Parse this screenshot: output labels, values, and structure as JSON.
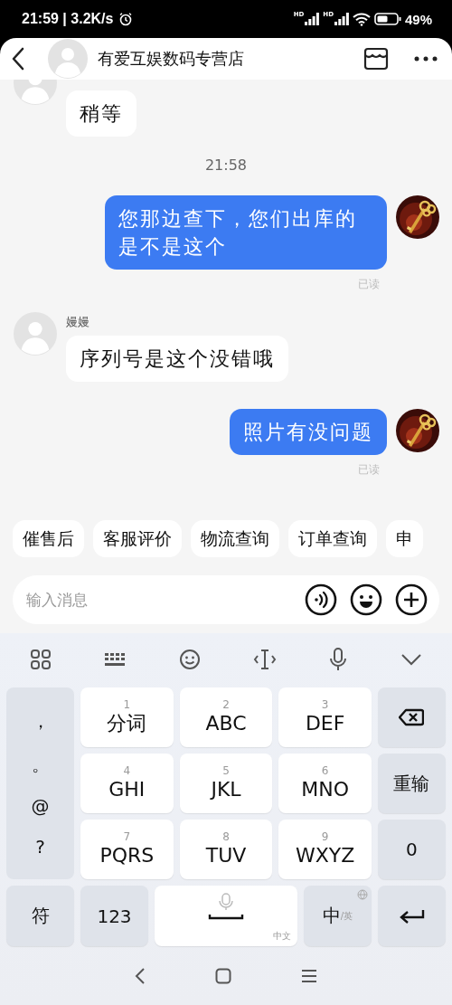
{
  "status_bar": {
    "clock": "21:59 | 3.2K/s",
    "signals": [
      "HD",
      "HD"
    ],
    "battery": "49%"
  },
  "header": {
    "title": "有爱互娱数码专营店"
  },
  "messages": [
    {
      "kind": "incoming",
      "text": "稍等"
    },
    {
      "kind": "time",
      "text": "21:58"
    },
    {
      "kind": "outgoing",
      "text": "您那边查下，您们出库的是不是这个",
      "status": "已读"
    },
    {
      "kind": "incoming",
      "name": "嫚嫚",
      "text": "序列号是这个没错哦"
    },
    {
      "kind": "outgoing",
      "text": "照片有没问题",
      "status": "已读"
    }
  ],
  "quick_replies": [
    "催售后",
    "客服评价",
    "物流查询",
    "订单查询",
    "申"
  ],
  "composer": {
    "placeholder": "输入消息"
  },
  "keyboard": {
    "symbols": [
      "，",
      "。",
      "@",
      "?"
    ],
    "keys": [
      {
        "digit": "1",
        "label": "分词"
      },
      {
        "digit": "2",
        "label": "ABC"
      },
      {
        "digit": "3",
        "label": "DEF"
      },
      {
        "digit": "4",
        "label": "GHI"
      },
      {
        "digit": "5",
        "label": "JKL"
      },
      {
        "digit": "6",
        "label": "MNO"
      },
      {
        "digit": "7",
        "label": "PQRS"
      },
      {
        "digit": "8",
        "label": "TUV"
      },
      {
        "digit": "9",
        "label": "WXYZ"
      }
    ],
    "right_keys": [
      {
        "kind": "backspace"
      },
      {
        "kind": "text",
        "label": "重输"
      },
      {
        "kind": "text",
        "label": "0"
      }
    ],
    "bottom": {
      "symbol": "符",
      "numbers": "123",
      "space_hint": "中文",
      "lang_main": "中",
      "lang_alt": "/英"
    }
  }
}
